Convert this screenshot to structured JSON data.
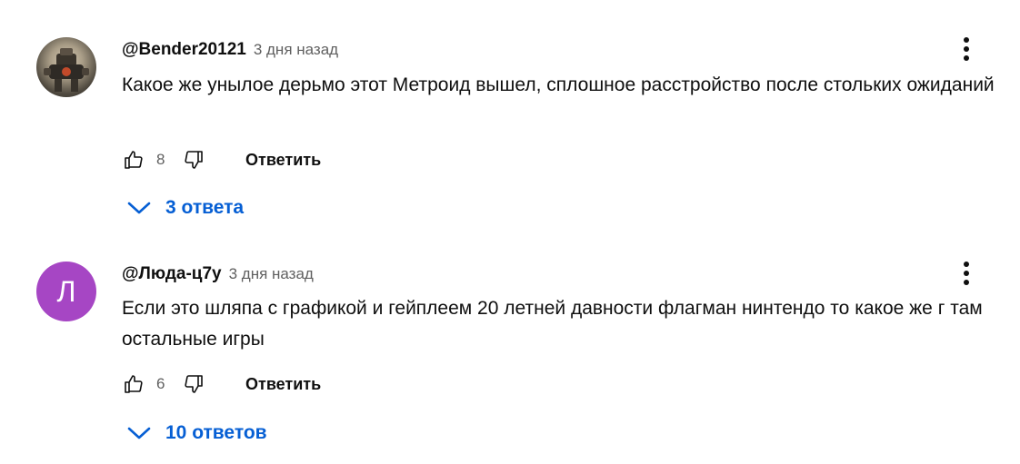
{
  "comments": [
    {
      "author": "@Bender20121",
      "time": "3 дня назад",
      "text": "Какое же унылое дерьмо этот Метроид вышел, сплошное расстройство после стольких ожиданий",
      "likes": "8",
      "reply_label": "Ответить",
      "replies_label": "3 ответа",
      "avatar_icon": "robot-armor-avatar"
    },
    {
      "author": "@Люда-ц7у",
      "time": "3 дня назад",
      "text": "Если это шляпа с графикой и гейплеем 20 летней давности флагман нинтендо то какое же г там остальные игры",
      "likes": "6",
      "reply_label": "Ответить",
      "replies_label": "10 ответов",
      "avatar_letter": "Л",
      "avatar_color": "#a646c4"
    }
  ],
  "colors": {
    "link_blue": "#065fd4",
    "secondary_text": "#606060",
    "primary_text": "#0f0f0f"
  }
}
